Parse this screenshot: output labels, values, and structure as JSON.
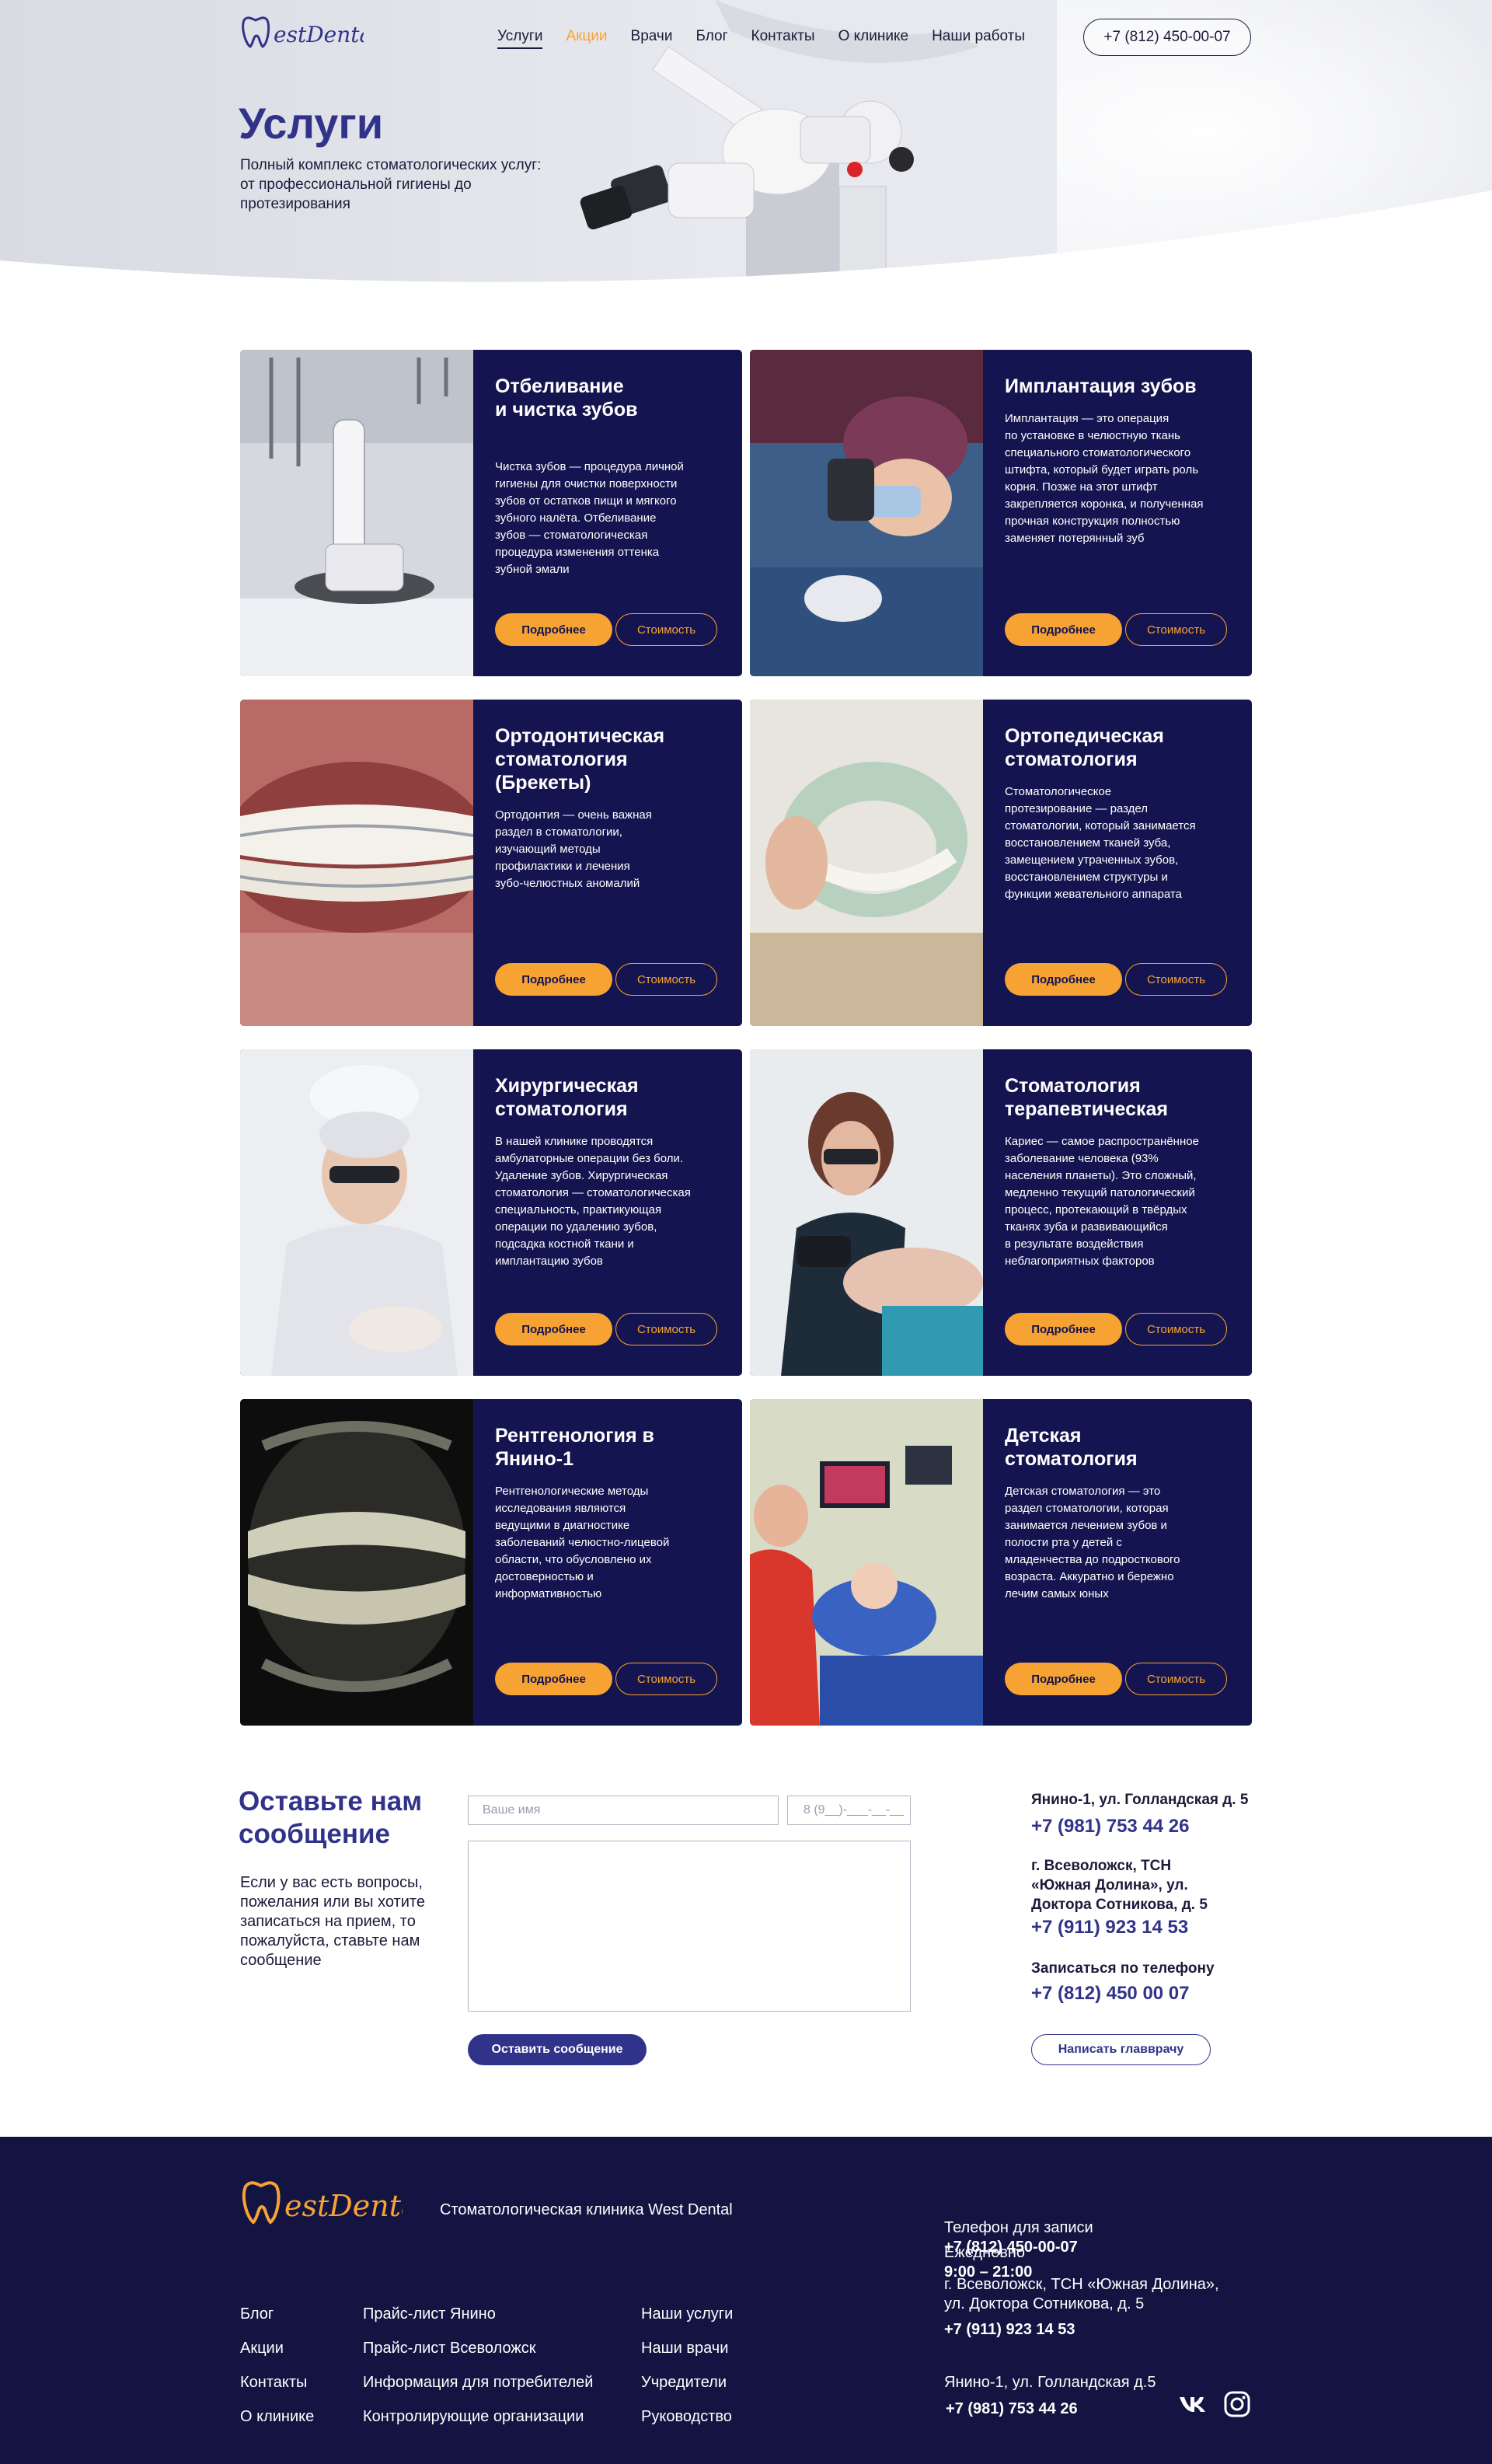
{
  "header": {
    "logo_text": "WestDental",
    "nav": [
      {
        "label": "Услуги"
      },
      {
        "label": "Акции"
      },
      {
        "label": "Врачи"
      },
      {
        "label": "Блог"
      },
      {
        "label": "Контакты"
      },
      {
        "label": "О клинике"
      },
      {
        "label": "Наши работы"
      }
    ],
    "phone": "+7 (812) 450-00-07"
  },
  "hero": {
    "title": "Услуги",
    "subtitle": "Полный комплекс стоматологических услуг: от профессиональной гигиены до протезирования"
  },
  "services": [
    {
      "title": "Отбеливание\nи чистка зубов",
      "text": "Чистка зубов — процедура личной\nгигиены для очистки поверхности\nзубов от остатков пищи и мягкого\nзубного налёта. Отбеливание\nзубов — стоматологическая\nпроцедура изменения оттенка\nзубной эмали",
      "more": "Подробнее",
      "price": "Стоимость",
      "image": "dental-scanner-photo"
    },
    {
      "title": "Имплантация зубов",
      "text": "Имплантация — это операция\nпо установке в челюстную ткань\nспециального стоматологического\nштифта, который будет играть роль\nкорня. Позже на этот штифт\nзакрепляется коронка, и полученная\nпрочная конструкция полностью\nзаменяет потерянный зуб",
      "more": "Подробнее",
      "price": "Стоимость",
      "image": "surgeon-microscope-photo"
    },
    {
      "title": "Ортодонтическая\nстоматология\n(Брекеты)",
      "text": "Ортодонтия — очень важная\nраздел в стоматологии,\nизучающий методы\nпрофилактики и лечения\nзубо-челюстных аномалий",
      "more": "Подробнее",
      "price": "Стоимость",
      "image": "braces-photo"
    },
    {
      "title": "Ортопедическая\nстоматология",
      "text": "Стоматологическое\nпротезирование — раздел\nстоматологии, который занимается\nвосстановлением тканей зуба,\nзамещением утраченных зубов,\nвосстановлением структуры и\nфункции жевательного аппарата",
      "more": "Подробнее",
      "price": "Стоимость",
      "image": "denture-photo"
    },
    {
      "title": "Хирургическая\nстоматология",
      "text": "В нашей клинике проводятся\nамбулаторные операции без боли.\nУдаление зубов. Хирургическая\nстоматология — стоматологическая\nспециальность, практикующая\nоперации по удалению зубов,\nподсадка костной ткани и\nимплантацию зубов",
      "more": "Подробнее",
      "price": "Стоимость",
      "image": "surgeon-photo"
    },
    {
      "title": "Стоматология\nтерапевтическая",
      "text": "Кариес — самое распространённое\nзаболевание человека (93%\nнаселения планеты). Это сложный,\nмедленно текущий патологический\nпроцесс, протекающий в твёрдых\nтканях зуба и развивающийся\nв результате воздействия\nнеблагоприятных факторов",
      "more": "Подробнее",
      "price": "Стоимость",
      "image": "dentist-patient-photo"
    },
    {
      "title": "Рентгенология в\nЯнино-1",
      "text": "Рентгенологические методы\nисследования являются\nведущими в диагностике\nзаболеваний челюстно-лицевой\nобласти, что обусловлено их\nдостоверностью и\nинформативностью",
      "more": "Подробнее",
      "price": "Стоимость",
      "image": "xray-photo"
    },
    {
      "title": "Детская\nстоматология",
      "text": "Детская стоматология — это\nраздел стоматологии, которая\nзанимается лечением зубов и\nполости рта у детей с\nмладенчества до подросткового\nвозраста.  Аккуратно и бережно\nлечим самых юных",
      "more": "Подробнее",
      "price": "Стоимость",
      "image": "kids-dentistry-photo"
    }
  ],
  "contact_form": {
    "title": "Оставьте нам\nсообщение",
    "description": "Если у вас есть вопросы, пожелания или вы хотите записаться на прием, то пожалуйста, ставьте нам сообщение",
    "name_placeholder": "Ваше имя",
    "phone_placeholder": "8 (9__)-___-__-__",
    "submit": "Оставить сообщение"
  },
  "addresses": [
    {
      "address": "Янино-1, ул. Голландская д. 5",
      "phone": "+7 (981) 753 44 26"
    },
    {
      "address": "г. Всеволожск, ТСН\n«Южная Долина», ул.\nДоктора Сотникова, д. 5",
      "phone": "+7 (911) 923 14 53"
    },
    {
      "address": "Записаться по телефону",
      "phone": "+7 (812) 450 00 07"
    }
  ],
  "chief_button": "Написать главврачу",
  "footer": {
    "logo_text": "WestDental",
    "tagline": "Стоматологическая клиника West Dental",
    "col1": [
      "Блог",
      "Акции",
      "Контакты",
      "О клинике"
    ],
    "col2": [
      "Прайс-лист Янино",
      "Прайс-лист Всеволожск",
      "Информация для потребителей",
      "Контролирующие организации"
    ],
    "col3": [
      "Наши услуги",
      "Наши врачи",
      "Учредители",
      "Руководство"
    ],
    "phone_label": "Телефон для записи",
    "phone": "+7 (812) 450-00-07",
    "hours_label": "Ежедневно",
    "hours": "9:00 – 21:00",
    "address1": "г. Всеволожск, ТСН «Южная Долина»,\nул. Доктора Сотникова, д. 5",
    "phone1": "+7 (911) 923 14 53",
    "address2": "Янино-1, ул. Голландская д.5",
    "phone2": "+7 (981) 753 44 26",
    "social": [
      "vk-icon",
      "instagram-icon"
    ]
  },
  "colors": {
    "navy": "#141450",
    "indigo": "#31338a",
    "orange": "#f7a333",
    "footer": "#141443"
  }
}
